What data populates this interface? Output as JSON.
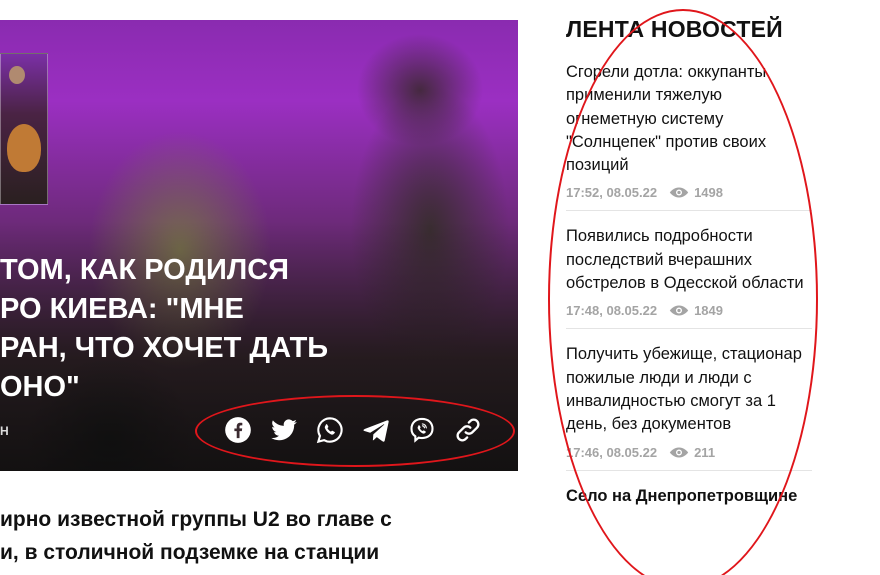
{
  "hero": {
    "title": "ТОМ, КАК РОДИЛСЯ\nРО КИЕВА: \"МНЕ\nРАН, ЧТО ХОЧЕТ ДАТЬ\nОНО\"",
    "author_fragment": "Н"
  },
  "share": {
    "buttons": [
      {
        "name": "facebook-icon"
      },
      {
        "name": "twitter-icon"
      },
      {
        "name": "whatsapp-icon"
      },
      {
        "name": "telegram-icon"
      },
      {
        "name": "viber-icon"
      },
      {
        "name": "link-icon"
      }
    ]
  },
  "lead": {
    "text": "ирно известной группы U2 во главе с\nи, в столичной подземке на станции"
  },
  "feed": {
    "title": "ЛЕНТА НОВОСТЕЙ",
    "items": [
      {
        "headline": "Сгорели дотла: оккупанты применили тяжелую огнеметную систему \"Солнцепек\" против своих позиций",
        "time": "17:52, 08.05.22",
        "views": "1498"
      },
      {
        "headline": "Появились подробности последствий вчерашних обстрелов в Одесской области",
        "time": "17:48, 08.05.22",
        "views": "1849"
      },
      {
        "headline": "Получить убежище, стационар пожилые люди и люди с инвалидностью смогут за 1 день, без документов",
        "time": "17:46, 08.05.22",
        "views": "211"
      },
      {
        "headline": "Село на Днепропетровщине"
      }
    ]
  },
  "colors": {
    "annotation": "#e0161b",
    "meta_gray": "#a4a4a4"
  }
}
